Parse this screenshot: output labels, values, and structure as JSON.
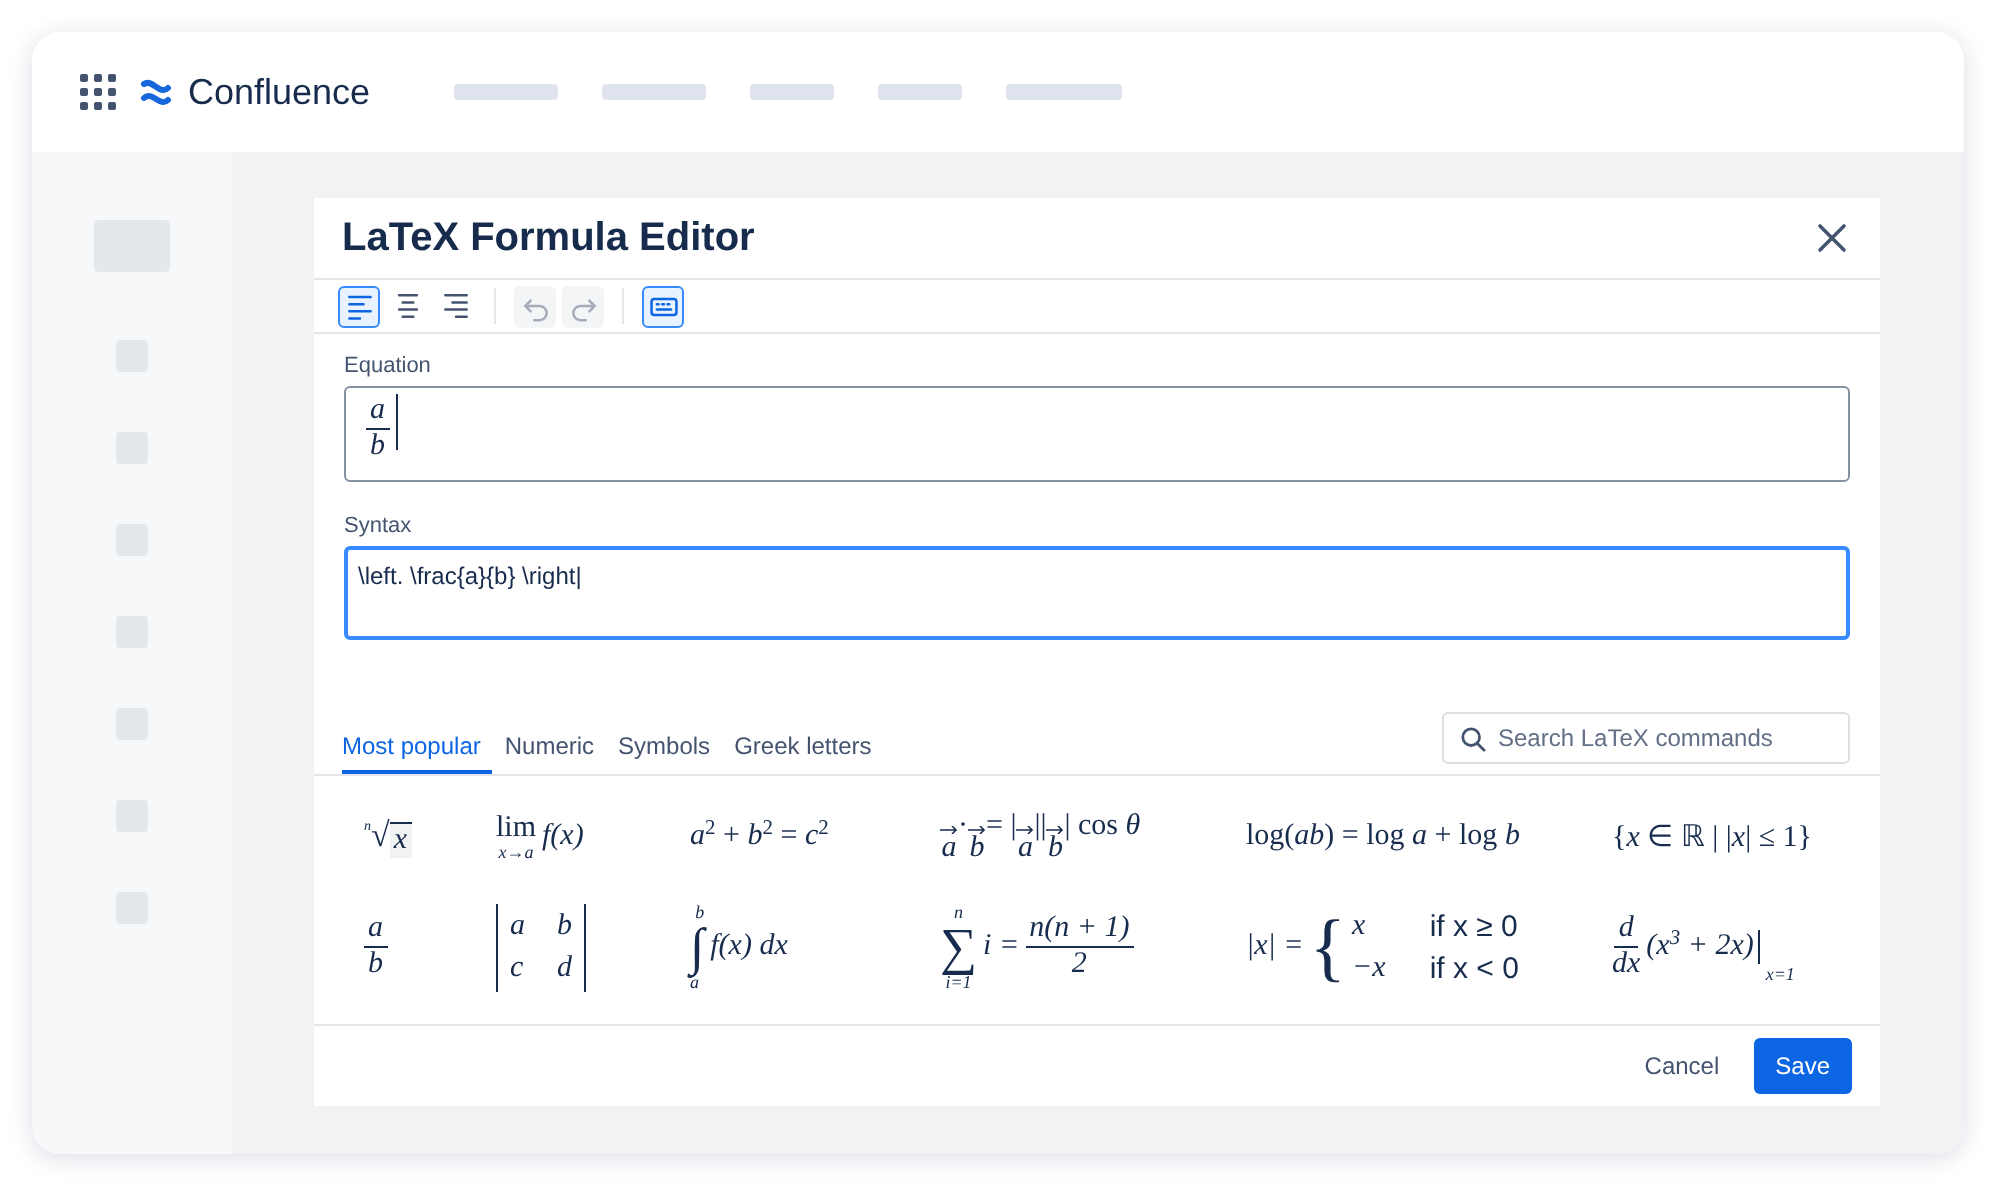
{
  "app": {
    "name": "Confluence"
  },
  "dialog": {
    "title": "LaTeX Formula Editor",
    "toolbar": [
      {
        "kind": "align-left",
        "selected": true,
        "disabled": false
      },
      {
        "kind": "align-center",
        "selected": false,
        "disabled": false
      },
      {
        "kind": "align-right",
        "selected": false,
        "disabled": false
      },
      {
        "kind": "undo",
        "selected": false,
        "disabled": true
      },
      {
        "kind": "redo",
        "selected": false,
        "disabled": true
      },
      {
        "kind": "keyboard",
        "selected": true,
        "disabled": false
      }
    ],
    "equation": {
      "label": "Equation",
      "formula": {
        "kind": "frac",
        "num": "a",
        "den": "b"
      }
    },
    "syntax": {
      "label": "Syntax",
      "value": "\\left. \\frac{a}{b} \\right|"
    },
    "tabs": [
      {
        "label": "Most popular",
        "selected": true
      },
      {
        "label": "Numeric",
        "selected": false
      },
      {
        "label": "Symbols",
        "selected": false
      },
      {
        "label": "Greek letters",
        "selected": false
      }
    ],
    "search": {
      "placeholder": "Search LaTeX commands"
    },
    "formulas": [
      {
        "kind": "root",
        "sign": "√",
        "index": "n",
        "radicand": "x"
      },
      {
        "kind": "limit",
        "op": "lim",
        "under": "x→a",
        "body": "f(x)"
      },
      {
        "kind": "inline",
        "text": "*a*$^{2}$ + *b*$^{2}$ = *c*$^{2}$"
      },
      {
        "kind": "sequence",
        "parts": [
          {
            "vec": "a"
          },
          {
            "text": "·"
          },
          {
            "vec": "b"
          },
          {
            "text": "= |"
          },
          {
            "vec": "a"
          },
          {
            "text": "||"
          },
          {
            "vec": "b"
          },
          {
            "text": "| cos *θ*"
          }
        ]
      },
      {
        "kind": "inline",
        "text": "log(*ab*) = log *a* + log *b*"
      },
      {
        "kind": "inline",
        "text": "{*x* ∈ ℝ | |*x*| ≤ 1}"
      },
      {
        "kind": "frac",
        "num": "a",
        "den": "b"
      },
      {
        "kind": "matrix",
        "rows": [
          [
            "a",
            "b"
          ],
          [
            "c",
            "d"
          ]
        ]
      },
      {
        "kind": "integral",
        "op": "∫",
        "upper": "b",
        "lower": "a",
        "body": "f(x) dx"
      },
      {
        "kind": "sum",
        "op": "∑",
        "upper": "n",
        "lower": "i=1",
        "body": "i =",
        "num": "n(n + 1)",
        "den": "2"
      },
      {
        "kind": "cases",
        "lhs": "|x| =",
        "brace": "{",
        "cases": [
          {
            "value": "x",
            "condition": "if x ≥ 0"
          },
          {
            "value": "−x",
            "condition": "if x < 0"
          }
        ]
      },
      {
        "kind": "derivative",
        "num": "d",
        "den": "dx",
        "body": "(x$^{3}$ + 2x)",
        "eval": "x=1"
      }
    ],
    "buttons": [
      {
        "label": "Cancel",
        "kind": "subtle"
      },
      {
        "label": "Save",
        "kind": "primary"
      }
    ]
  }
}
